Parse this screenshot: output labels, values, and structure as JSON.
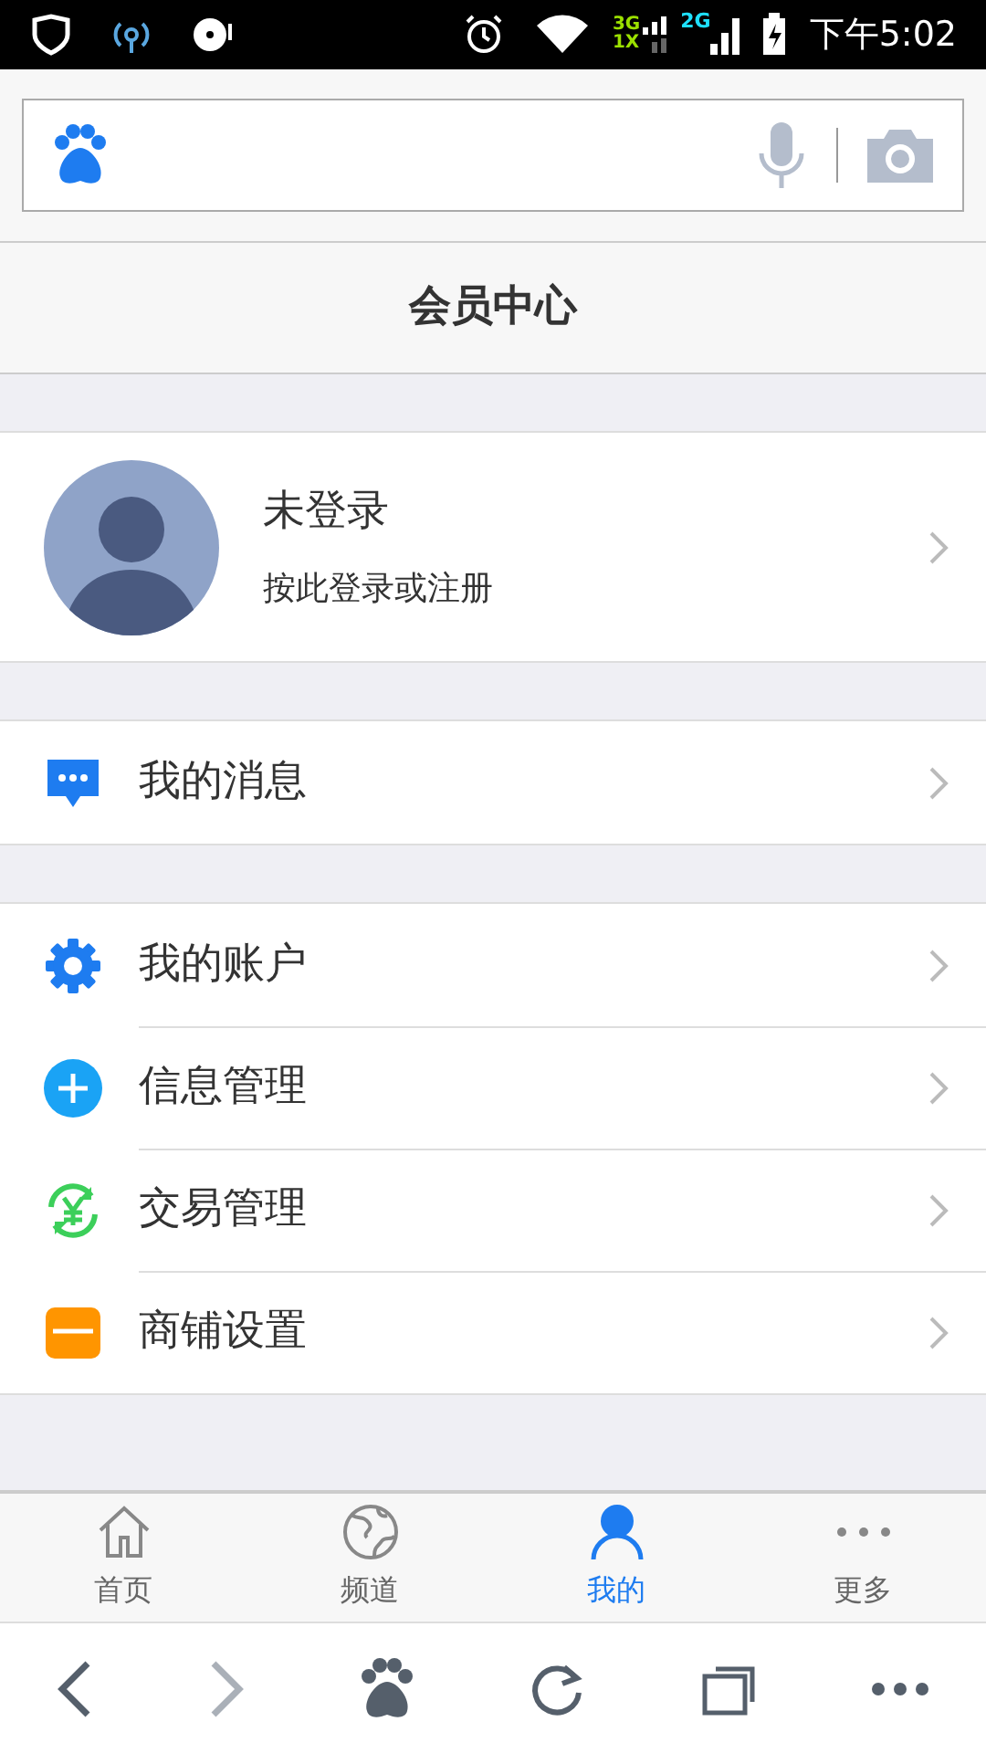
{
  "status_bar": {
    "net_a": "3G",
    "net_b": "1X",
    "net_c": "2G",
    "time": "下午5:02"
  },
  "page_title": "会员中心",
  "profile": {
    "name": "未登录",
    "hint": "按此登录或注册"
  },
  "menu_groups": [
    [
      {
        "kind": "message",
        "label": "我的消息"
      }
    ],
    [
      {
        "kind": "gear",
        "label": "我的账户"
      },
      {
        "kind": "plus",
        "label": "信息管理"
      },
      {
        "kind": "yen",
        "label": "交易管理"
      },
      {
        "kind": "shop",
        "label": "商铺设置"
      }
    ]
  ],
  "tabs": [
    {
      "kind": "home",
      "label": "首页",
      "selected": false
    },
    {
      "kind": "globe",
      "label": "频道",
      "selected": false
    },
    {
      "kind": "person",
      "label": "我的",
      "selected": true
    },
    {
      "kind": "more",
      "label": "更多",
      "selected": false
    }
  ]
}
